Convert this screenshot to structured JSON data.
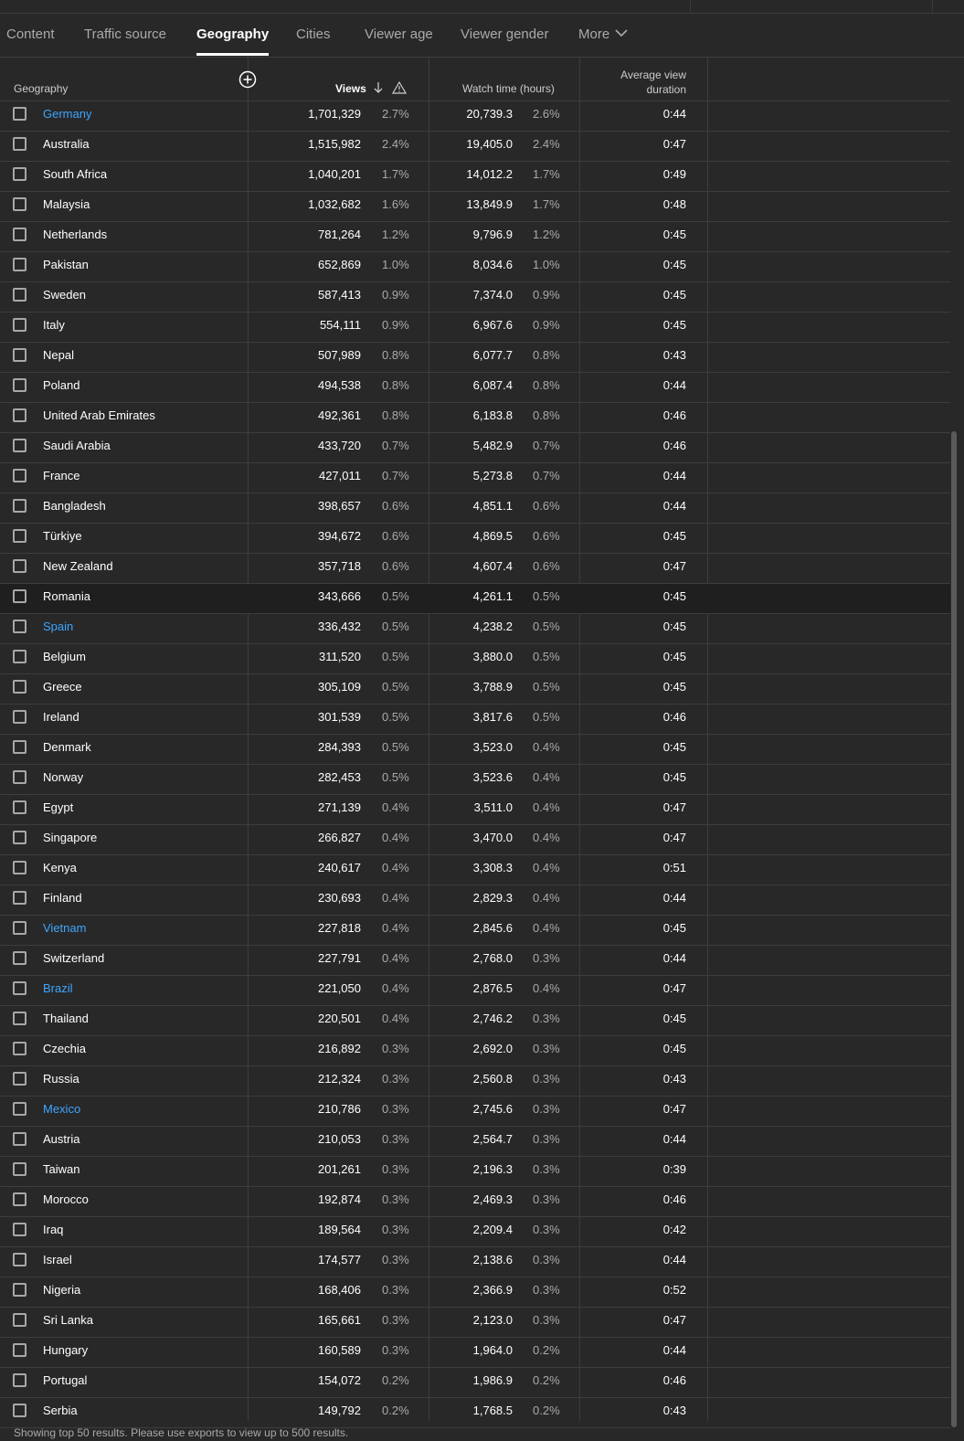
{
  "tabs": [
    {
      "label": "Content"
    },
    {
      "label": "Traffic source"
    },
    {
      "label": "Geography"
    },
    {
      "label": "Cities"
    },
    {
      "label": "Viewer age"
    },
    {
      "label": "Viewer gender"
    },
    {
      "label": "More"
    }
  ],
  "active_tab": "Geography",
  "table": {
    "columns": {
      "geography": "Geography",
      "views": "Views",
      "watch_time": "Watch time (hours)",
      "avg_view_duration_line1": "Average view",
      "avg_view_duration_line2": "duration"
    },
    "rows": [
      {
        "country": "Germany",
        "views": "1,701,329",
        "views_pct": "2.7%",
        "watch": "20,739.3",
        "watch_pct": "2.6%",
        "avd": "0:44",
        "link": true
      },
      {
        "country": "Australia",
        "views": "1,515,982",
        "views_pct": "2.4%",
        "watch": "19,405.0",
        "watch_pct": "2.4%",
        "avd": "0:47"
      },
      {
        "country": "South Africa",
        "views": "1,040,201",
        "views_pct": "1.7%",
        "watch": "14,012.2",
        "watch_pct": "1.7%",
        "avd": "0:49"
      },
      {
        "country": "Malaysia",
        "views": "1,032,682",
        "views_pct": "1.6%",
        "watch": "13,849.9",
        "watch_pct": "1.7%",
        "avd": "0:48"
      },
      {
        "country": "Netherlands",
        "views": "781,264",
        "views_pct": "1.2%",
        "watch": "9,796.9",
        "watch_pct": "1.2%",
        "avd": "0:45"
      },
      {
        "country": "Pakistan",
        "views": "652,869",
        "views_pct": "1.0%",
        "watch": "8,034.6",
        "watch_pct": "1.0%",
        "avd": "0:45"
      },
      {
        "country": "Sweden",
        "views": "587,413",
        "views_pct": "0.9%",
        "watch": "7,374.0",
        "watch_pct": "0.9%",
        "avd": "0:45"
      },
      {
        "country": "Italy",
        "views": "554,111",
        "views_pct": "0.9%",
        "watch": "6,967.6",
        "watch_pct": "0.9%",
        "avd": "0:45"
      },
      {
        "country": "Nepal",
        "views": "507,989",
        "views_pct": "0.8%",
        "watch": "6,077.7",
        "watch_pct": "0.8%",
        "avd": "0:43"
      },
      {
        "country": "Poland",
        "views": "494,538",
        "views_pct": "0.8%",
        "watch": "6,087.4",
        "watch_pct": "0.8%",
        "avd": "0:44"
      },
      {
        "country": "United Arab Emirates",
        "views": "492,361",
        "views_pct": "0.8%",
        "watch": "6,183.8",
        "watch_pct": "0.8%",
        "avd": "0:46"
      },
      {
        "country": "Saudi Arabia",
        "views": "433,720",
        "views_pct": "0.7%",
        "watch": "5,482.9",
        "watch_pct": "0.7%",
        "avd": "0:46"
      },
      {
        "country": "France",
        "views": "427,011",
        "views_pct": "0.7%",
        "watch": "5,273.8",
        "watch_pct": "0.7%",
        "avd": "0:44"
      },
      {
        "country": "Bangladesh",
        "views": "398,657",
        "views_pct": "0.6%",
        "watch": "4,851.1",
        "watch_pct": "0.6%",
        "avd": "0:44"
      },
      {
        "country": "Türkiye",
        "views": "394,672",
        "views_pct": "0.6%",
        "watch": "4,869.5",
        "watch_pct": "0.6%",
        "avd": "0:45"
      },
      {
        "country": "New Zealand",
        "views": "357,718",
        "views_pct": "0.6%",
        "watch": "4,607.4",
        "watch_pct": "0.6%",
        "avd": "0:47"
      },
      {
        "country": "Romania",
        "views": "343,666",
        "views_pct": "0.5%",
        "watch": "4,261.1",
        "watch_pct": "0.5%",
        "avd": "0:45",
        "highlighted": true
      },
      {
        "country": "Spain",
        "views": "336,432",
        "views_pct": "0.5%",
        "watch": "4,238.2",
        "watch_pct": "0.5%",
        "avd": "0:45",
        "link": true
      },
      {
        "country": "Belgium",
        "views": "311,520",
        "views_pct": "0.5%",
        "watch": "3,880.0",
        "watch_pct": "0.5%",
        "avd": "0:45"
      },
      {
        "country": "Greece",
        "views": "305,109",
        "views_pct": "0.5%",
        "watch": "3,788.9",
        "watch_pct": "0.5%",
        "avd": "0:45"
      },
      {
        "country": "Ireland",
        "views": "301,539",
        "views_pct": "0.5%",
        "watch": "3,817.6",
        "watch_pct": "0.5%",
        "avd": "0:46"
      },
      {
        "country": "Denmark",
        "views": "284,393",
        "views_pct": "0.5%",
        "watch": "3,523.0",
        "watch_pct": "0.4%",
        "avd": "0:45"
      },
      {
        "country": "Norway",
        "views": "282,453",
        "views_pct": "0.5%",
        "watch": "3,523.6",
        "watch_pct": "0.4%",
        "avd": "0:45"
      },
      {
        "country": "Egypt",
        "views": "271,139",
        "views_pct": "0.4%",
        "watch": "3,511.0",
        "watch_pct": "0.4%",
        "avd": "0:47"
      },
      {
        "country": "Singapore",
        "views": "266,827",
        "views_pct": "0.4%",
        "watch": "3,470.0",
        "watch_pct": "0.4%",
        "avd": "0:47"
      },
      {
        "country": "Kenya",
        "views": "240,617",
        "views_pct": "0.4%",
        "watch": "3,308.3",
        "watch_pct": "0.4%",
        "avd": "0:51"
      },
      {
        "country": "Finland",
        "views": "230,693",
        "views_pct": "0.4%",
        "watch": "2,829.3",
        "watch_pct": "0.4%",
        "avd": "0:44"
      },
      {
        "country": "Vietnam",
        "views": "227,818",
        "views_pct": "0.4%",
        "watch": "2,845.6",
        "watch_pct": "0.4%",
        "avd": "0:45",
        "link": true
      },
      {
        "country": "Switzerland",
        "views": "227,791",
        "views_pct": "0.4%",
        "watch": "2,768.0",
        "watch_pct": "0.3%",
        "avd": "0:44"
      },
      {
        "country": "Brazil",
        "views": "221,050",
        "views_pct": "0.4%",
        "watch": "2,876.5",
        "watch_pct": "0.4%",
        "avd": "0:47",
        "link": true
      },
      {
        "country": "Thailand",
        "views": "220,501",
        "views_pct": "0.4%",
        "watch": "2,746.2",
        "watch_pct": "0.3%",
        "avd": "0:45"
      },
      {
        "country": "Czechia",
        "views": "216,892",
        "views_pct": "0.3%",
        "watch": "2,692.0",
        "watch_pct": "0.3%",
        "avd": "0:45"
      },
      {
        "country": "Russia",
        "views": "212,324",
        "views_pct": "0.3%",
        "watch": "2,560.8",
        "watch_pct": "0.3%",
        "avd": "0:43"
      },
      {
        "country": "Mexico",
        "views": "210,786",
        "views_pct": "0.3%",
        "watch": "2,745.6",
        "watch_pct": "0.3%",
        "avd": "0:47",
        "link": true
      },
      {
        "country": "Austria",
        "views": "210,053",
        "views_pct": "0.3%",
        "watch": "2,564.7",
        "watch_pct": "0.3%",
        "avd": "0:44"
      },
      {
        "country": "Taiwan",
        "views": "201,261",
        "views_pct": "0.3%",
        "watch": "2,196.3",
        "watch_pct": "0.3%",
        "avd": "0:39"
      },
      {
        "country": "Morocco",
        "views": "192,874",
        "views_pct": "0.3%",
        "watch": "2,469.3",
        "watch_pct": "0.3%",
        "avd": "0:46"
      },
      {
        "country": "Iraq",
        "views": "189,564",
        "views_pct": "0.3%",
        "watch": "2,209.4",
        "watch_pct": "0.3%",
        "avd": "0:42"
      },
      {
        "country": "Israel",
        "views": "174,577",
        "views_pct": "0.3%",
        "watch": "2,138.6",
        "watch_pct": "0.3%",
        "avd": "0:44"
      },
      {
        "country": "Nigeria",
        "views": "168,406",
        "views_pct": "0.3%",
        "watch": "2,366.9",
        "watch_pct": "0.3%",
        "avd": "0:52"
      },
      {
        "country": "Sri Lanka",
        "views": "165,661",
        "views_pct": "0.3%",
        "watch": "2,123.0",
        "watch_pct": "0.3%",
        "avd": "0:47"
      },
      {
        "country": "Hungary",
        "views": "160,589",
        "views_pct": "0.3%",
        "watch": "1,964.0",
        "watch_pct": "0.2%",
        "avd": "0:44"
      },
      {
        "country": "Portugal",
        "views": "154,072",
        "views_pct": "0.2%",
        "watch": "1,986.9",
        "watch_pct": "0.2%",
        "avd": "0:46"
      },
      {
        "country": "Serbia",
        "views": "149,792",
        "views_pct": "0.2%",
        "watch": "1,768.5",
        "watch_pct": "0.2%",
        "avd": "0:43"
      }
    ]
  },
  "footer": {
    "text": "Showing top 50 results. Please use exports to view up to 500 results."
  },
  "colors": {
    "background": "#282828",
    "link": "#3ea6ff",
    "divider": "#3d3d3d",
    "highlight_row": "#1f1f1f"
  },
  "icons": {
    "add_column": "plus-circle-icon",
    "sort": "arrow-down-icon",
    "warning": "warning-triangle-icon",
    "more": "chevron-down-icon"
  }
}
